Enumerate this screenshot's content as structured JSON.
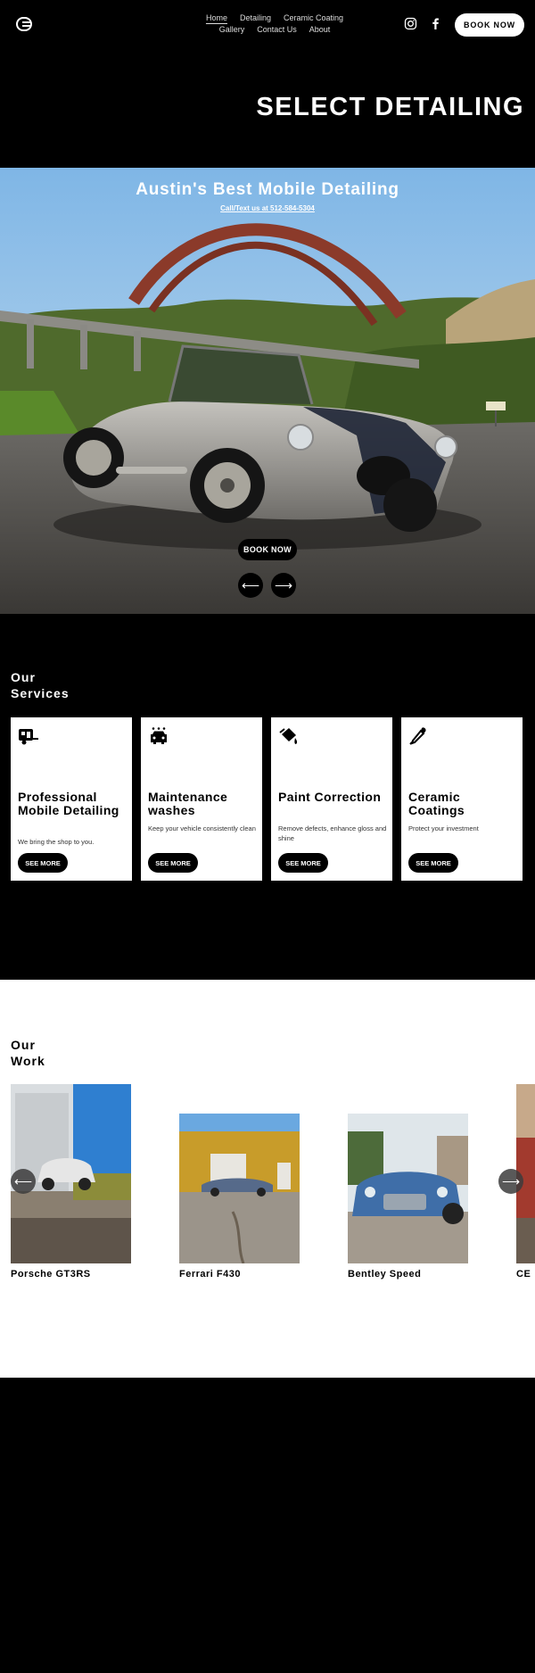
{
  "header": {
    "nav_row1": [
      "Home",
      "Detailing",
      "Ceramic Coating"
    ],
    "nav_row2": [
      "Gallery",
      "Contact Us",
      "About"
    ],
    "book_label": "BOOK NOW"
  },
  "brand": "SELECT DETAILING",
  "hero": {
    "title": "Austin's Best Mobile Detailing",
    "subtitle": "Call/Text us at 512-584-5304",
    "book_label": "BOOK NOW",
    "prev_icon": "arrow-left-icon",
    "next_icon": "arrow-right-icon"
  },
  "services": {
    "title_line1": "Our",
    "title_line2": "Services",
    "cards": [
      {
        "title": "Professional Mobile Detailing",
        "desc": "We bring the shop to you.",
        "button": "SEE MORE",
        "icon": "trailer-icon"
      },
      {
        "title": "Maintenance washes",
        "desc": "Keep your vehicle consistently clean",
        "button": "SEE MORE",
        "icon": "car-wash-icon"
      },
      {
        "title": "Paint Correction",
        "desc": "Remove defects, enhance gloss and shine",
        "button": "SEE MORE",
        "icon": "paint-bucket-icon"
      },
      {
        "title": "Ceramic Coatings",
        "desc": "Protect your investment",
        "button": "SEE MORE",
        "icon": "dropper-icon"
      }
    ]
  },
  "work": {
    "title_line1": "Our",
    "title_line2": "Work",
    "items": [
      "Porsche GT3RS",
      "Ferrari F430",
      "Bentley Speed",
      "CE"
    ]
  },
  "colors": {
    "background": "#000000",
    "accent": "#ffffff",
    "bridge": "#8b3a2a",
    "car": "#9a9893"
  }
}
